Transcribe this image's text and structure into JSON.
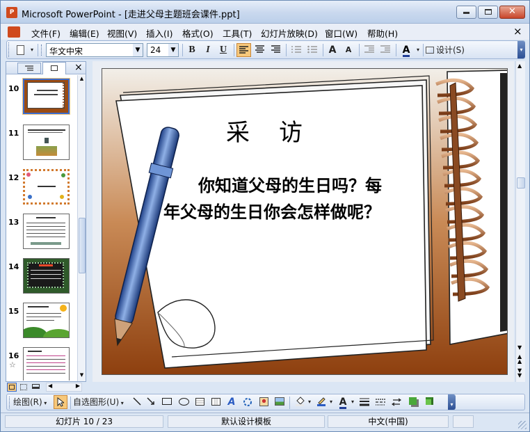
{
  "window": {
    "title": "Microsoft PowerPoint - [走进父母主题班会课件.ppt]",
    "app_icon_label": "P",
    "controls": [
      "minimize",
      "restore",
      "close"
    ]
  },
  "menu": {
    "items": [
      "文件(F)",
      "编辑(E)",
      "视图(V)",
      "插入(I)",
      "格式(O)",
      "工具(T)",
      "幻灯片放映(D)",
      "窗口(W)",
      "帮助(H)"
    ],
    "close_doc": "×"
  },
  "toolbar": {
    "font_name": "华文中宋",
    "font_size": "24",
    "bold": "B",
    "italic": "I",
    "underline": "U",
    "font_color_letter": "A",
    "grow_font": "A",
    "shrink_font": "A",
    "design_label": "设计(S)"
  },
  "left_pane": {
    "close": "×",
    "slides": [
      {
        "num": "10",
        "kind": "notebook",
        "selected": true
      },
      {
        "num": "11",
        "kind": "photo"
      },
      {
        "num": "12",
        "kind": "flowers"
      },
      {
        "num": "13",
        "kind": "text"
      },
      {
        "num": "14",
        "kind": "dark"
      },
      {
        "num": "15",
        "kind": "sunhill"
      },
      {
        "num": "16",
        "kind": "list",
        "star": "☆"
      }
    ]
  },
  "slide": {
    "title": "采　访",
    "body_line1": "你知道父母的生日吗？每",
    "body_line2": "年父母的生日你会怎样做呢？"
  },
  "draw_toolbar": {
    "draw_label": "绘图(R)",
    "autoshapes_label": "自选图形(U)"
  },
  "status": {
    "slide_info": "幻灯片 10 / 23",
    "template": "默认设计模板",
    "language": "中文(中国)"
  },
  "colors": {
    "accent_orange": "#f7c87b",
    "slide_bg_brown": "#9a4b12",
    "window_blue": "#dbe6f4"
  }
}
